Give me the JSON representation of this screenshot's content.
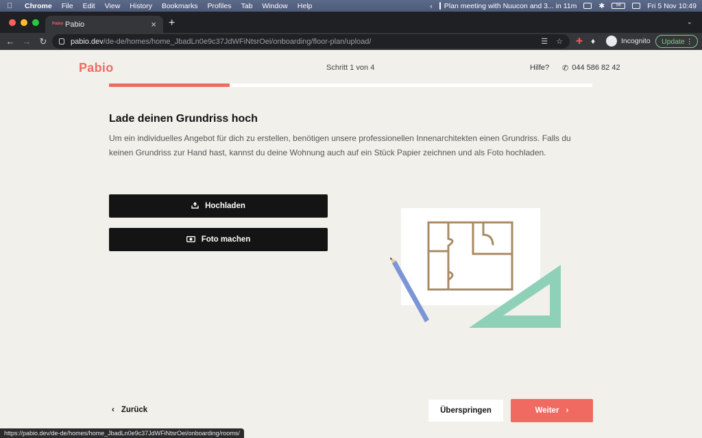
{
  "menubar": {
    "app": "Chrome",
    "items": [
      "File",
      "Edit",
      "View",
      "History",
      "Bookmarks",
      "Profiles",
      "Tab",
      "Window",
      "Help"
    ],
    "calendar": "Plan meeting with Nuucon and 3... in 11m",
    "battery": "56",
    "datetime": "Fri 5 Nov  10:49"
  },
  "browser": {
    "tab_title": "Pabio",
    "favicon_text": "Pabio",
    "url_host": "pabio.dev",
    "url_path": "/de-de/homes/home_JbadLn0e9c37JdWFiNtsrOei/onboarding/floor-plan/upload/",
    "profile_label": "Incognito",
    "update_label": "Update",
    "status_url": "https://pabio.dev/de-de/homes/home_JbadLn0e9c37JdWFiNtsrOei/onboarding/rooms/"
  },
  "header": {
    "logo": "Pabio",
    "step": "Schritt 1 von 4",
    "help": "Hilfe?",
    "phone": "044 586 82 42"
  },
  "progress": {
    "value": 0.25
  },
  "main": {
    "heading": "Lade deinen Grundriss hoch",
    "description": "Um ein individuelles Angebot für dich zu erstellen, benötigen unsere professionellen Innenarchitekten einen Grundriss. Falls du keinen Grundriss zur Hand hast, kannst du deine Wohnung auch auf ein Stück Papier zeichnen und als Foto hochladen.",
    "upload_label": "Hochladen",
    "photo_label": "Foto machen"
  },
  "footer": {
    "back_label": "Zurück",
    "skip_label": "Überspringen",
    "next_label": "Weiter"
  },
  "colors": {
    "brand": "#f06a62",
    "dark_button": "#141414",
    "background": "#f2f0eb",
    "floorplan_lines": "#a88a64",
    "ruler": "#8fd1b8",
    "pencil": "#7b95d6"
  },
  "icons": {
    "upload": "upload-icon",
    "camera": "camera-icon",
    "phone": "phone-icon",
    "back": "chevron-left-icon",
    "next": "chevron-right-icon"
  }
}
